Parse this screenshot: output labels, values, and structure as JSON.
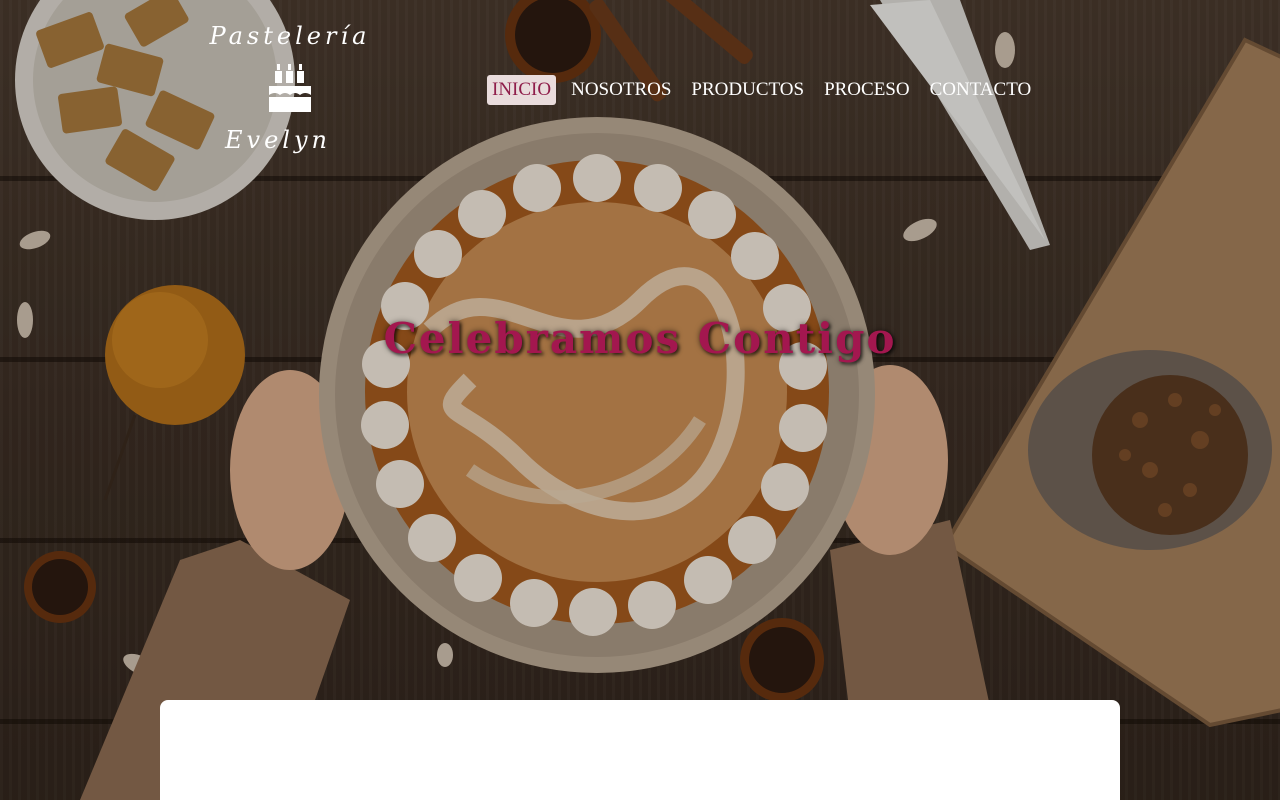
{
  "brand": {
    "line1": "Pastelería",
    "line2": "Evelyn",
    "icon": "birthday-cake-icon"
  },
  "nav": {
    "items": [
      {
        "label": "INICIO",
        "active": true
      },
      {
        "label": "NOSOTROS",
        "active": false
      },
      {
        "label": "PRODUCTOS",
        "active": false
      },
      {
        "label": "PROCESO",
        "active": false
      },
      {
        "label": "CONTACTO",
        "active": false
      }
    ]
  },
  "hero": {
    "headline": "Celebramos Contigo"
  },
  "colors": {
    "accent": "#a3174f",
    "nav_active_bg": "#e9dcdc",
    "wood_dark": "#33271e",
    "card_bg": "#ffffff"
  }
}
